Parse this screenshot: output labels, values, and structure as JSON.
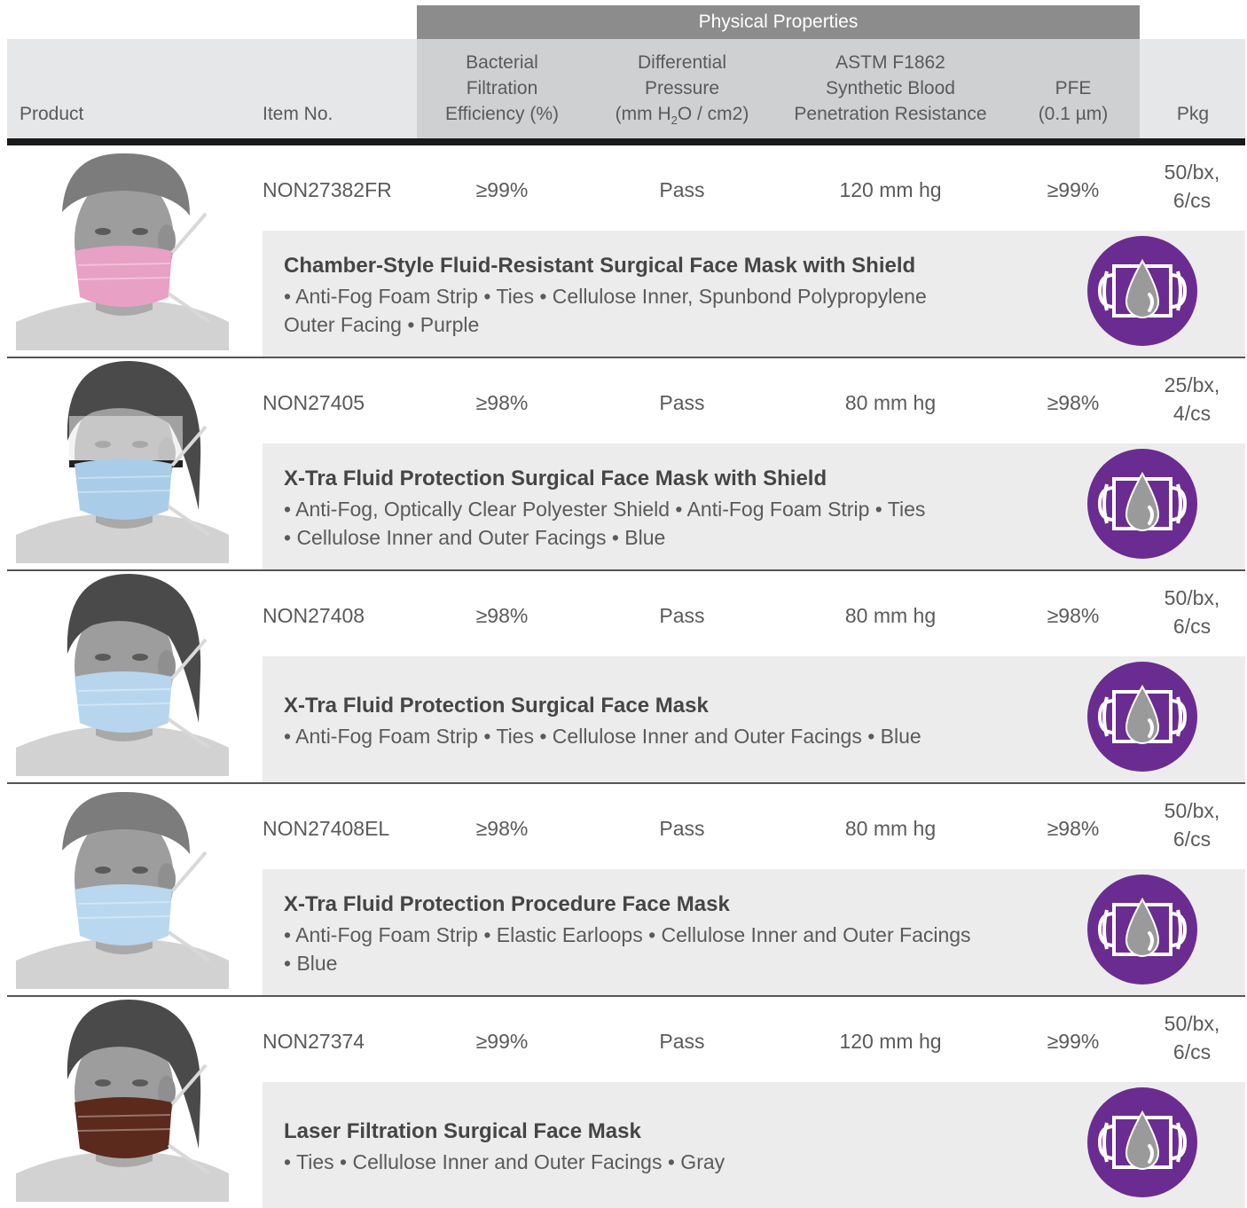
{
  "header": {
    "group_label": "Physical Properties",
    "product": "Product",
    "item_no": "Item No.",
    "bfe": [
      "Bacterial",
      "Filtration",
      "Efficiency (%)"
    ],
    "diff_pressure": [
      "Differential",
      "Pressure"
    ],
    "diff_pressure_unit": {
      "pre": "(mm H",
      "sub": "2",
      "post": "O / cm2)"
    },
    "astm": [
      "ASTM F1862",
      "Synthetic Blood",
      "Penetration Resistance"
    ],
    "pfe": [
      "PFE",
      "(0.1 µm)"
    ],
    "pkg": "Pkg"
  },
  "colors": {
    "badge": "#6b2c91",
    "header_band": "#8c8c8c",
    "property_bg": "#cfd0d2"
  },
  "badge_icon": "fluid-resistant-mask-icon",
  "products": [
    {
      "item_no": "NON27382FR",
      "bfe": "≥99%",
      "diff_pressure": "Pass",
      "astm": "120 mm hg",
      "pfe": "≥99%",
      "pkg": [
        "50/bx,",
        "6/cs"
      ],
      "title": "Chamber-Style Fluid-Resistant Surgical Face Mask with Shield",
      "features": [
        "• Anti-Fog Foam Strip  • Ties  • Cellulose Inner, Spunbond Polypropylene",
        "Outer Facing • Purple"
      ],
      "mask_color": "#e8a0c4",
      "cap": "bouffant"
    },
    {
      "item_no": "NON27405",
      "bfe": "≥98%",
      "diff_pressure": "Pass",
      "astm": "80 mm hg",
      "pfe": "≥98%",
      "pkg": [
        "25/bx,",
        "4/cs"
      ],
      "title": "X-Tra Fluid Protection Surgical Face Mask with Shield",
      "features": [
        "• Anti-Fog, Optically Clear Polyester Shield • Anti-Fog Foam Strip • Ties",
        "• Cellulose Inner and Outer Facings • Blue"
      ],
      "mask_color": "#a9cde8",
      "cap": "hood"
    },
    {
      "item_no": "NON27408",
      "bfe": "≥98%",
      "diff_pressure": "Pass",
      "astm": "80 mm hg",
      "pfe": "≥98%",
      "pkg": [
        "50/bx,",
        "6/cs"
      ],
      "title": "X-Tra Fluid Protection Surgical Face Mask",
      "features": [
        "• Anti-Fog Foam Strip • Ties • Cellulose Inner and Outer Facings • Blue"
      ],
      "mask_color": "#b7d6ee",
      "cap": "hood"
    },
    {
      "item_no": "NON27408EL",
      "bfe": "≥98%",
      "diff_pressure": "Pass",
      "astm": "80 mm hg",
      "pfe": "≥98%",
      "pkg": [
        "50/bx,",
        "6/cs"
      ],
      "title": "X-Tra Fluid Protection Procedure Face Mask",
      "features": [
        "• Anti-Fog Foam Strip • Elastic Earloops • Cellulose Inner and Outer Facings",
        "• Blue"
      ],
      "mask_color": "#b9d7ee",
      "cap": "bouffant"
    },
    {
      "item_no": "NON27374",
      "bfe": "≥99%",
      "diff_pressure": "Pass",
      "astm": "120 mm hg",
      "pfe": "≥99%",
      "pkg": [
        "50/bx,",
        "6/cs"
      ],
      "title": "Laser Filtration Surgical Face Mask",
      "features": [
        "• Ties • Cellulose Inner and Outer Facings • Gray"
      ],
      "mask_color": "#5b2a1c",
      "cap": "hood"
    }
  ]
}
